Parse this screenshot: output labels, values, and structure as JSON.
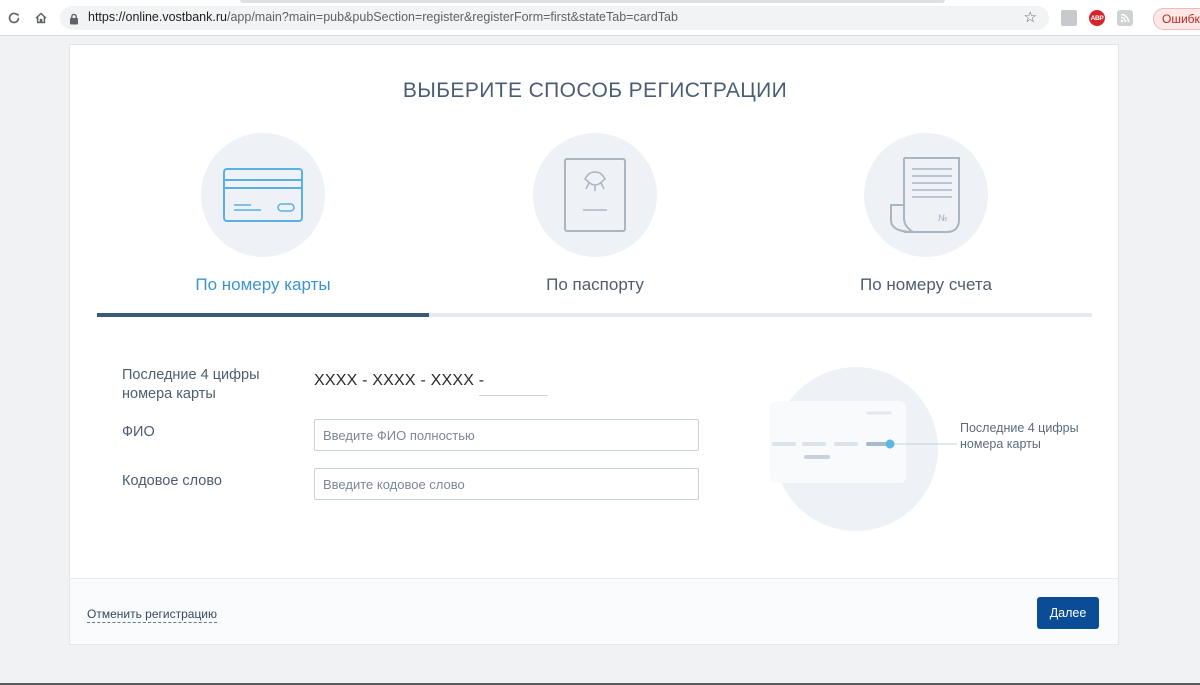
{
  "browser": {
    "url_host": "https://online.vostbank.ru",
    "url_path": "/app/main?main=pub&pubSection=register&registerForm=first&stateTab=cardTab",
    "error_chip": "Ошибка",
    "abp_label": "ABP",
    "icons": [
      "reload-icon",
      "home-icon",
      "lock-icon",
      "star-icon",
      "extension-icon",
      "adblock-icon",
      "rss-icon"
    ]
  },
  "page": {
    "title": "ВЫБЕРИТЕ СПОСОБ РЕГИСТРАЦИИ",
    "methods": [
      {
        "label": "По номеру карты",
        "icon": "bank-card-icon",
        "active": true
      },
      {
        "label": "По паспорту",
        "icon": "passport-icon",
        "active": false
      },
      {
        "label": "По номеру счета",
        "icon": "account-document-icon",
        "active": false
      }
    ],
    "form": {
      "card_label": "Последние 4 цифры номера карты",
      "card_mask": "XXXX - XXXX - XXXX -",
      "card_digits_value": "",
      "fio_label": "ФИО",
      "fio_placeholder": "Введите ФИО полностью",
      "fio_value": "",
      "code_label": "Кодовое слово",
      "code_placeholder": "Введите кодовое слово",
      "code_value": ""
    },
    "hint": "Последние 4 цифры номера карты",
    "footer": {
      "cancel_label": "Отменить регистрацию",
      "next_label": "Далее"
    }
  },
  "colors": {
    "accent_blue": "#3a95cf",
    "button_blue": "#0a4d96",
    "active_tab": "#3b5a78",
    "title_text": "#4a5d75"
  }
}
